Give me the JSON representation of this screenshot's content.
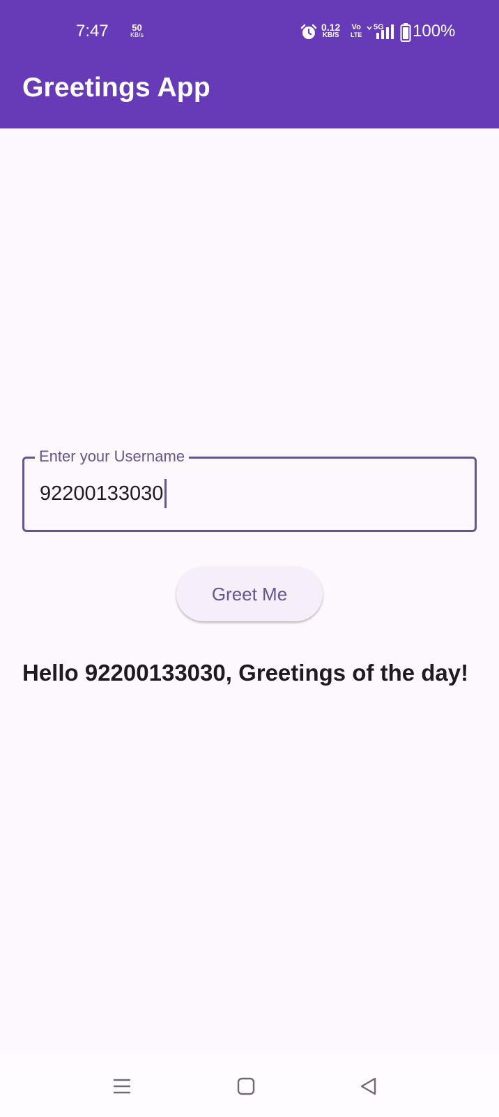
{
  "status_bar": {
    "time": "7:47",
    "speed_value": "50",
    "speed_unit": "KB/s",
    "net_speed_value": "0.12",
    "net_speed_unit": "KB/S",
    "volte_top": "Vo",
    "volte_bottom": "LTE",
    "network": "5G",
    "battery_percent": "100%",
    "icons": [
      "alarm-icon",
      "signal-icon",
      "battery-icon"
    ]
  },
  "app_bar": {
    "title": "Greetings App"
  },
  "form": {
    "username_label": "Enter your Username",
    "username_value": "92200133030",
    "greet_button": "Greet Me"
  },
  "result": {
    "greeting": "Hello 92200133030, Greetings of the day!"
  },
  "nav_bar": {
    "icons": [
      "menu-icon",
      "home-icon",
      "back-icon"
    ]
  },
  "colors": {
    "primary": "#673ab7",
    "accent": "#65558f",
    "background": "#fdf7fe",
    "text": "#1d1b20"
  }
}
